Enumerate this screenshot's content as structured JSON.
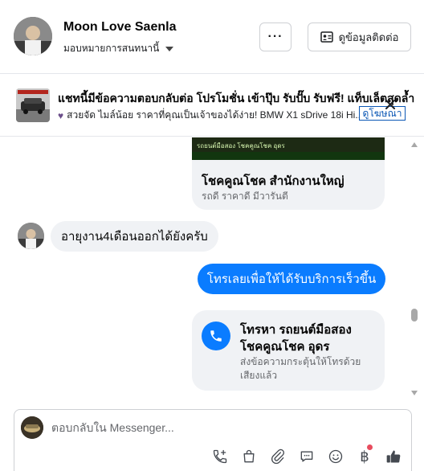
{
  "header": {
    "contact_name": "Moon Love Saenla",
    "assign_label": "มอบหมายการสนทนานี้",
    "more_label": "···",
    "contact_info_label": "ดูข้อมูลติดต่อ"
  },
  "ad": {
    "title": "แชทนี้มีข้อความตอบกลับต่อ โปรโมชั่น เข้าปุ๊บ รับปั๊บ รับฟรี! แท็บเล็ตสุดล้ำ",
    "subtitle": "สวยจัด ไมล์น้อย ราคาที่คุณเป็นเจ้าของได้ง่าย! BMW X1 sDrive 18i Hi...",
    "link_label": "ดูโฆษณา"
  },
  "chat": {
    "card_image_text": "รถยนต์มือสอง โชคคูณโชค อุดร",
    "card_title": "โชคคูณโชค สำนักงานใหญ่",
    "card_subtitle": "รถดี ราคาดี มีวารันตี",
    "incoming_message": "อายุงาน4เดือนออกได้ยังครับ",
    "outgoing_message": "โทรเลยเพื่อให้ได้รับบริการเร็วขึ้น",
    "call_title": "โทรหา รถยนต์มือสอง โชคคูณโชค อุดร",
    "call_subtitle": "ส่งข้อความกระตุ้นให้โทรด้วยเสียงแล้ว"
  },
  "composer": {
    "placeholder": "ตอบกลับใน Messenger...",
    "baht_symbol": "฿"
  },
  "colors": {
    "accent": "#0a7cff",
    "link": "#0b57b5",
    "bubble_gray": "#f0f2f5",
    "notification_dot": "#e84c5e"
  },
  "icons": [
    "more-icon",
    "contact-card-icon",
    "heart-icon",
    "close-icon",
    "phone-icon",
    "add-call-icon",
    "shopping-bag-icon",
    "paperclip-icon",
    "chat-bubble-icon",
    "emoji-icon",
    "baht-icon",
    "thumbs-up-icon"
  ]
}
